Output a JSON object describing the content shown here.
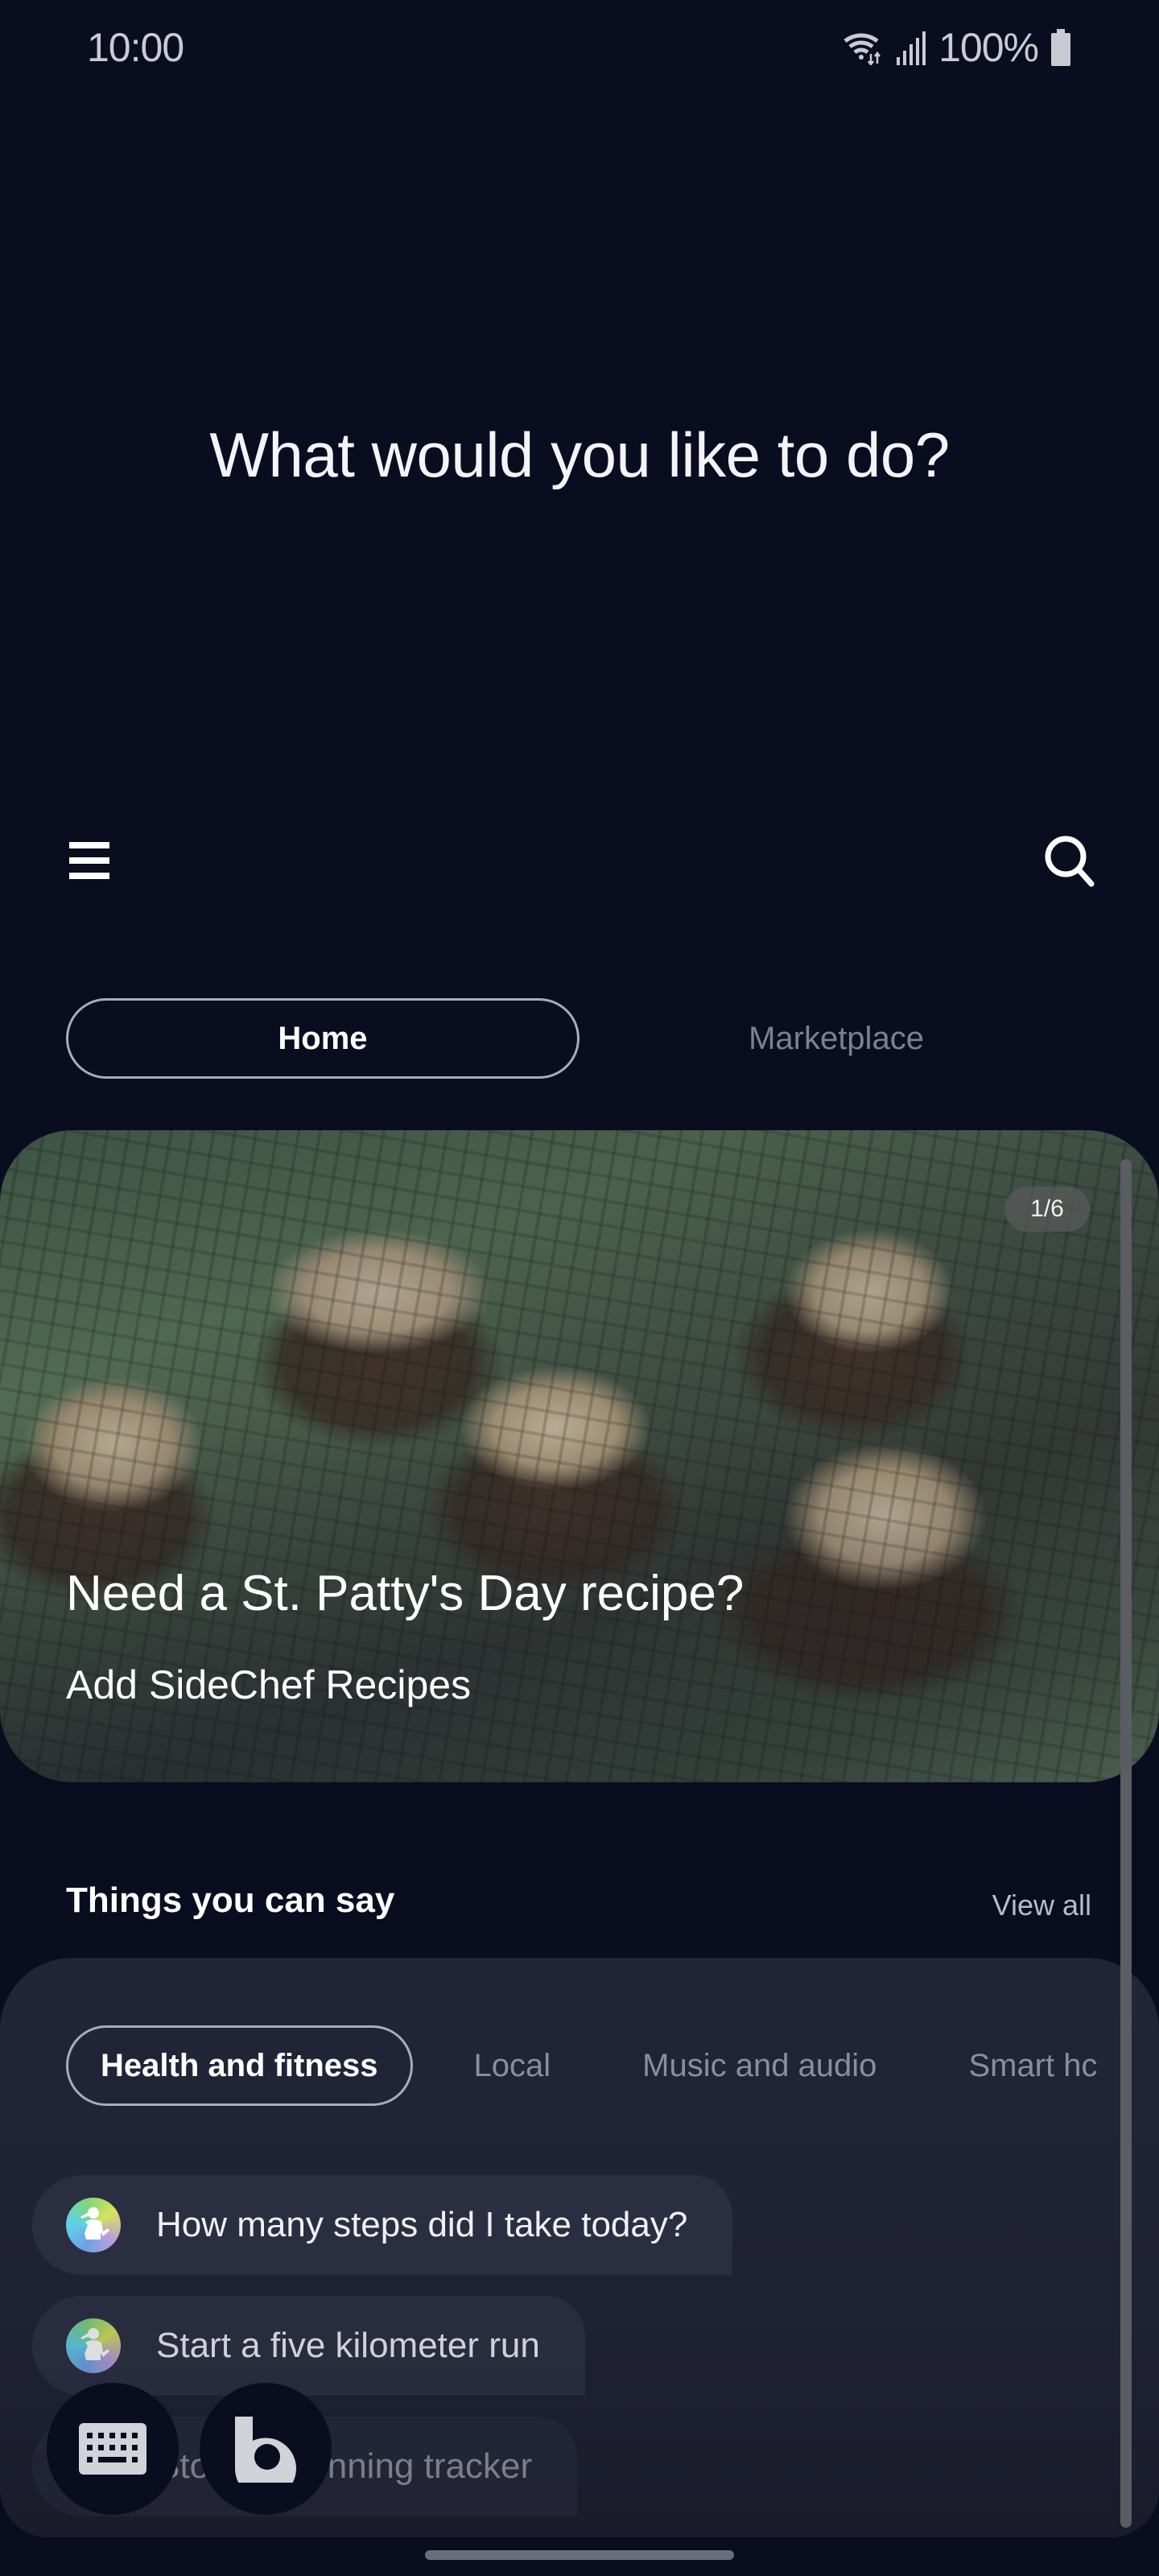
{
  "status_bar": {
    "time": "10:00",
    "battery": "100%",
    "icons": [
      "wifi-icon",
      "signal-icon",
      "battery-icon"
    ]
  },
  "greeting": "What would you like to do?",
  "toolbar": {
    "menu_icon": "hamburger-menu-icon",
    "search_icon": "search-icon"
  },
  "tabs": [
    {
      "label": "Home",
      "active": true
    },
    {
      "label": "Marketplace",
      "active": false
    }
  ],
  "hero": {
    "counter": "1/6",
    "title": "Need a St. Patty's Day recipe?",
    "subtitle": "Add SideChef Recipes",
    "image": "cupcakes-on-cooling-rack"
  },
  "things_you_can_say": {
    "title": "Things you can say",
    "view_all": "View all",
    "categories": [
      {
        "label": "Health and fitness",
        "active": true
      },
      {
        "label": "Local",
        "active": false
      },
      {
        "label": "Music and audio",
        "active": false
      },
      {
        "label": "Smart hc",
        "active": false
      }
    ],
    "utterances": [
      {
        "text": "How many steps did I take today?",
        "icon": "samsung-health-icon"
      },
      {
        "text": "Start a five kilometer run",
        "icon": "samsung-health-icon"
      },
      {
        "text": "Stop my running tracker",
        "icon": "samsung-health-icon"
      }
    ]
  },
  "floating_buttons": {
    "keyboard": "keyboard-icon",
    "bixby": "bixby-icon"
  },
  "colors": {
    "background": "#0a0d1f",
    "panel": "#222538",
    "utterance_bg": "#2b2e40",
    "inactive_text": "#7d8090"
  }
}
